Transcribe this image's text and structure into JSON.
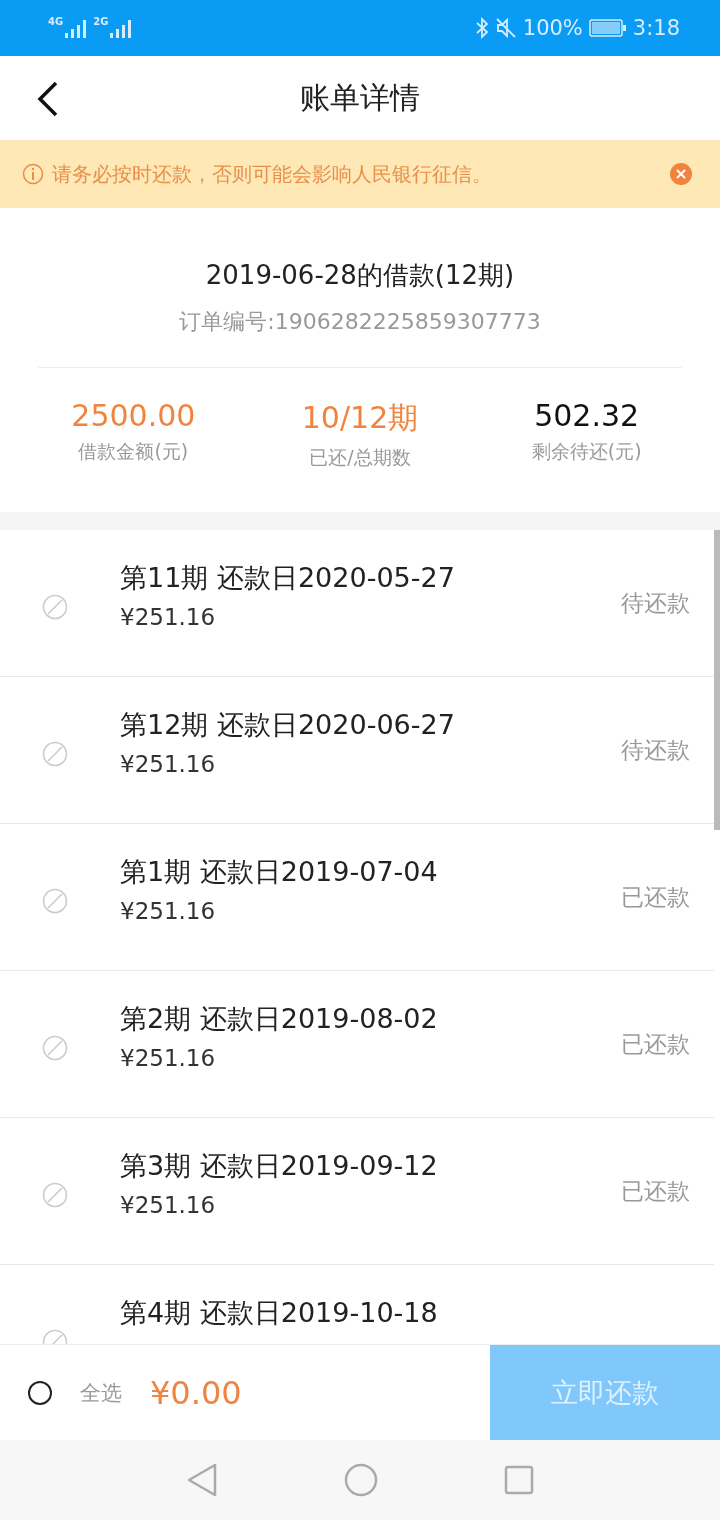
{
  "status_bar": {
    "network_1": "4G",
    "network_2": "2G",
    "battery": "100%",
    "time": "3:18"
  },
  "header": {
    "title": "账单详情"
  },
  "notice": {
    "text": "请务必按时还款，否则可能会影响人民银行征信。"
  },
  "loan": {
    "title": "2019-06-28的借款(12期)",
    "order_no": "订单编号:1906282225859307773",
    "stats": [
      {
        "value": "2500.00",
        "label": "借款金额(元)",
        "highlight": true
      },
      {
        "value": "10/12期",
        "label": "已还/总期数",
        "highlight": true
      },
      {
        "value": "502.32",
        "label": "剩余待还(元)",
        "highlight": false
      }
    ]
  },
  "installments": [
    {
      "title": "第11期 还款日2020-05-27",
      "amount": "¥251.16",
      "status": "待还款"
    },
    {
      "title": "第12期 还款日2020-06-27",
      "amount": "¥251.16",
      "status": "待还款"
    },
    {
      "title": "第1期 还款日2019-07-04",
      "amount": "¥251.16",
      "status": "已还款"
    },
    {
      "title": "第2期 还款日2019-08-02",
      "amount": "¥251.16",
      "status": "已还款"
    },
    {
      "title": "第3期 还款日2019-09-12",
      "amount": "¥251.16",
      "status": "已还款"
    },
    {
      "title": "第4期 还款日2019-10-18"
    }
  ],
  "footer": {
    "select_all": {
      "label": "全选",
      "checked": false
    },
    "total": "¥0.00",
    "pay_button": {
      "label": "立即还款",
      "disabled": true
    }
  }
}
